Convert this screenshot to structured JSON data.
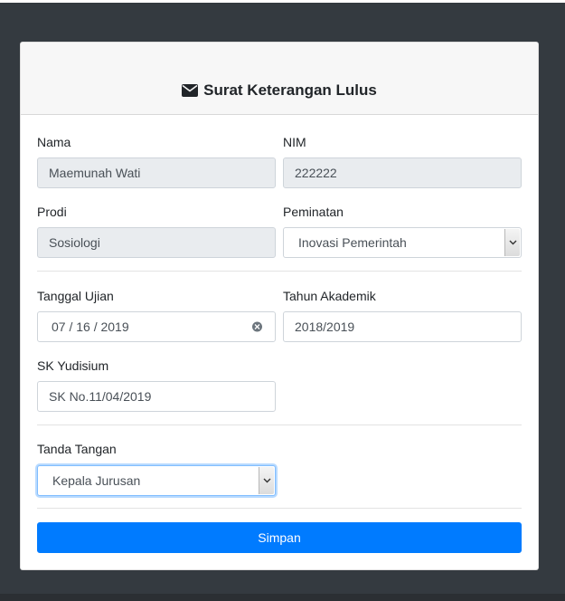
{
  "form": {
    "title": "Surat Keterangan Lulus",
    "nama": {
      "label": "Nama",
      "value": "Maemunah Wati"
    },
    "nim": {
      "label": "NIM",
      "value": "222222"
    },
    "prodi": {
      "label": "Prodi",
      "value": "Sosiologi"
    },
    "peminatan": {
      "label": "Peminatan",
      "value": "Inovasi Pemerintah"
    },
    "tanggal_ujian": {
      "label": "Tanggal Ujian",
      "value": "07 / 16 / 2019"
    },
    "tahun_akademik": {
      "label": "Tahun Akademik",
      "value": "2018/2019"
    },
    "sk_yudisium": {
      "label": "SK Yudisium",
      "value": "SK No.11/04/2019"
    },
    "tanda_tangan": {
      "label": "Tanda Tangan",
      "value": "Kepala Jurusan"
    },
    "save_label": "Simpan"
  },
  "icons": {
    "title_icon": "envelope-icon",
    "clear": "clear-date-icon",
    "dropdown": "chevron-down-icon"
  },
  "colors": {
    "primary": "#007bff",
    "background": "#343a40",
    "readonly": "#e9ecef"
  }
}
